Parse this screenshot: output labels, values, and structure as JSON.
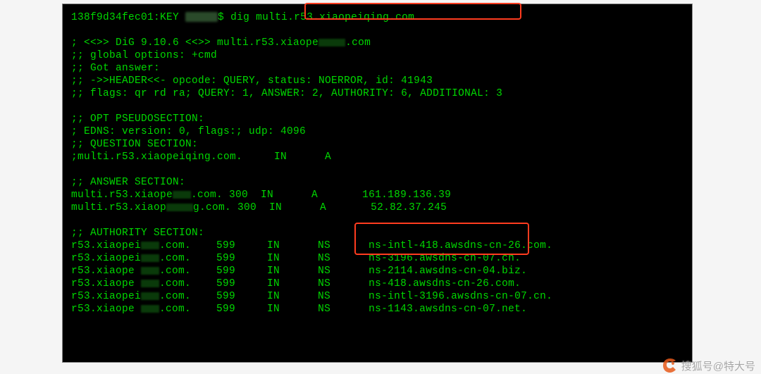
{
  "prompt": {
    "prefix": "138f9d34fec01:KEY",
    "symbol": "$",
    "command": "dig multi.r53.xiaopeiqing.com"
  },
  "header": {
    "l1": "; <<>> DiG 9.10.6 <<>> multi.r53.xiaope",
    "l1b": ".com",
    "l2": ";; global options: +cmd",
    "l3": ";; Got answer:",
    "l4": ";; ->>HEADER<<- opcode: QUERY, status: NOERROR, id: 41943",
    "l5": ";; flags: qr rd ra; QUERY: 1, ANSWER: 2, AUTHORITY: 6, ADDITIONAL: 3"
  },
  "opt": {
    "title": ";; OPT PSEUDOSECTION:",
    "l1": "; EDNS: version: 0, flags:; udp: 4096"
  },
  "question": {
    "title": ";; QUESTION SECTION:",
    "l1": ";multi.r53.xiaopeiqing.com.     IN      A"
  },
  "answer": {
    "title": ";; ANSWER SECTION:",
    "rows": [
      {
        "p1": "multi.r53.xiaope",
        "p2": ".com. 300  IN      A       161.189.136.39"
      },
      {
        "p1": "multi.r53.xiaop",
        "p2": "g.com. 300  IN      A       52.82.37.245"
      }
    ]
  },
  "authority": {
    "title": ";; AUTHORITY SECTION:",
    "rows": [
      {
        "p1": "r53.xiaopei",
        "p2": ".com.    599     IN      NS      ns-intl-418.awsdns-cn-26.com."
      },
      {
        "p1": "r53.xiaopei",
        "p2": ".com.    599     IN      NS      ns-3196.awsdns-cn-07.cn."
      },
      {
        "p1": "r53.xiaope",
        "p2": ".com.    599     IN      NS      ns-2114.awsdns-cn-04.biz."
      },
      {
        "p1": "r53.xiaope",
        "p2": ".com.    599     IN      NS      ns-418.awsdns-cn-26.com."
      },
      {
        "p1": "r53.xiaopei",
        "p2": ".com.    599     IN      NS      ns-intl-3196.awsdns-cn-07.cn."
      },
      {
        "p1": "r53.xiaope",
        "p2": ".com.    599     IN      NS      ns-1143.awsdns-cn-07.net."
      }
    ]
  },
  "watermark": "搜狐号@特大号"
}
